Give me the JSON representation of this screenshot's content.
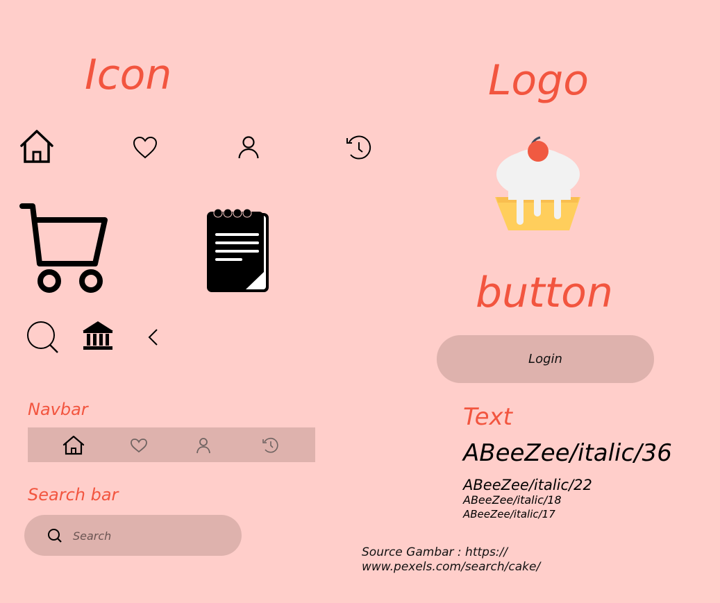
{
  "headings": {
    "icon": "Icon",
    "logo": "Logo",
    "button": "button",
    "navbar": "Navbar",
    "search_bar": "Search bar",
    "text": "Text"
  },
  "icons": [
    {
      "name": "home-icon"
    },
    {
      "name": "heart-icon"
    },
    {
      "name": "user-icon"
    },
    {
      "name": "history-icon"
    },
    {
      "name": "shopping-cart-icon"
    },
    {
      "name": "notepad-icon"
    },
    {
      "name": "search-icon"
    },
    {
      "name": "bank-icon"
    },
    {
      "name": "chevron-left-icon"
    }
  ],
  "logo": {
    "name": "cupcake-logo"
  },
  "navbar": {
    "items": [
      {
        "icon": "home-icon",
        "active": true
      },
      {
        "icon": "heart-icon",
        "active": false
      },
      {
        "icon": "user-icon",
        "active": false
      },
      {
        "icon": "history-icon",
        "active": false
      }
    ]
  },
  "search": {
    "placeholder": "Search"
  },
  "button": {
    "login_label": "Login"
  },
  "text_samples": [
    "ABeeZee/italic/36",
    "ABeeZee/italic/22",
    "ABeeZee/italic/18",
    "ABeeZee/italic/17"
  ],
  "source": {
    "line1": "Source Gambar : https://",
    "line2": "www.pexels.com/search/cake/"
  },
  "colors": {
    "background": "#FFCECA",
    "accent": "#F2553F",
    "surface": "#DEB2AD",
    "inactive_icon": "#6f6361"
  }
}
